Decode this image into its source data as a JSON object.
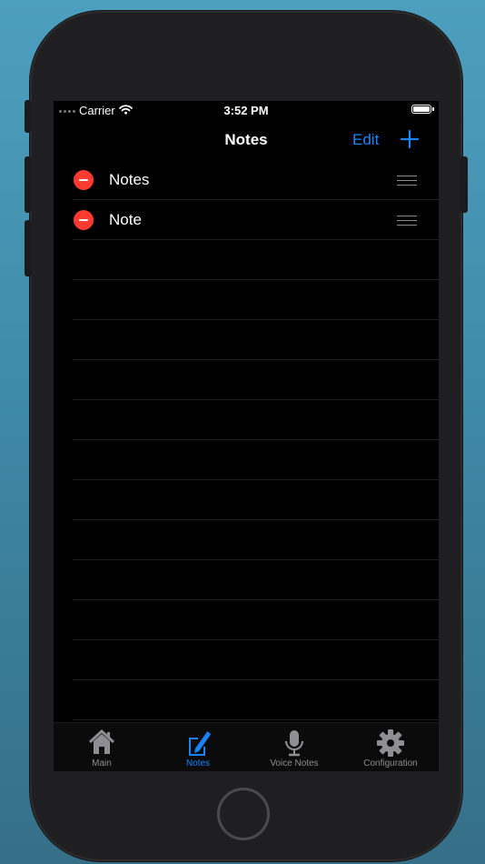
{
  "status_bar": {
    "carrier": "Carrier",
    "time": "3:52 PM",
    "battery_level": 1.0
  },
  "nav": {
    "title": "Notes",
    "edit_label": "Edit",
    "add_icon": "plus-icon"
  },
  "list": {
    "items": [
      {
        "label": "Notes"
      },
      {
        "label": "Note"
      }
    ],
    "empty_rows": 12
  },
  "tab_bar": {
    "active_tab": "Notes",
    "tabs": [
      {
        "label": "Main",
        "icon": "house-icon"
      },
      {
        "label": "Notes",
        "icon": "note-pencil-icon"
      },
      {
        "label": "Voice Notes",
        "icon": "microphone-icon"
      },
      {
        "label": "Configuration",
        "icon": "gear-icon"
      }
    ]
  },
  "colors": {
    "accent": "#1a84ff",
    "delete": "#ff3b30",
    "background": "#000000",
    "inactive_tab": "#8e8e93"
  }
}
